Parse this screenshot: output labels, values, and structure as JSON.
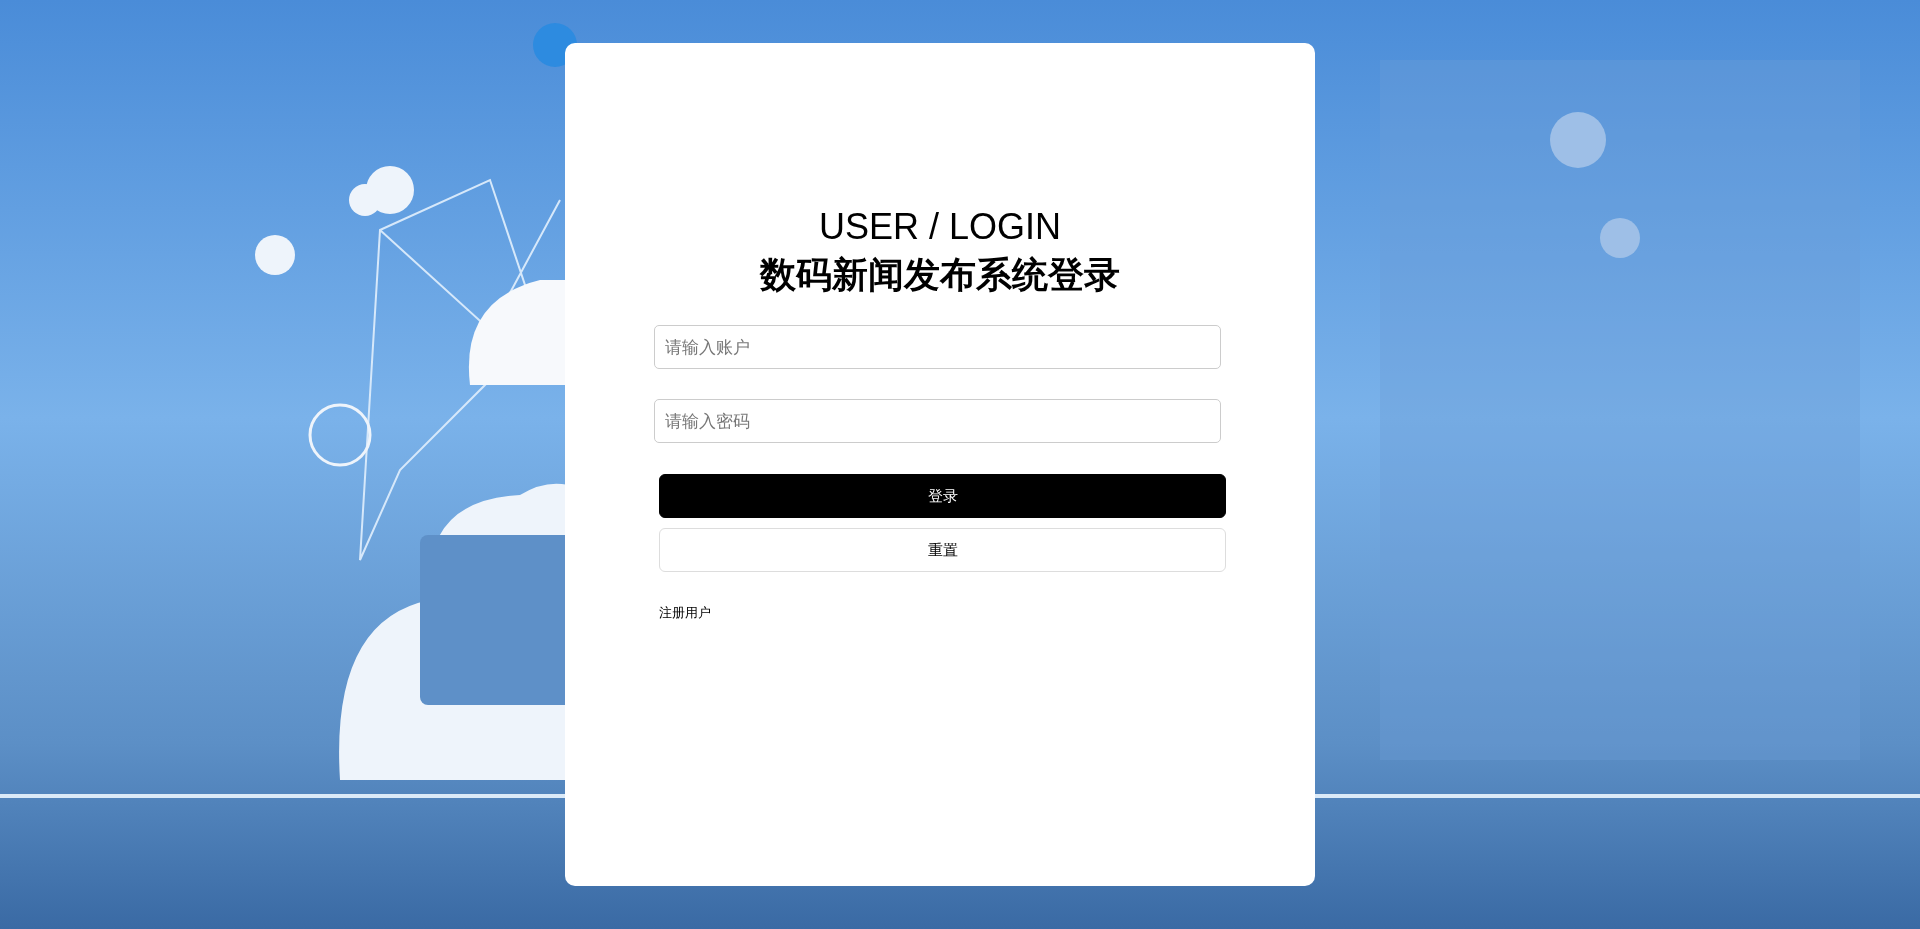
{
  "login": {
    "heading": "USER / LOGIN",
    "title": "数码新闻发布系统登录",
    "fields": [
      {
        "placeholder": "请输入账户"
      },
      {
        "placeholder": "请输入密码"
      }
    ],
    "buttons": [
      {
        "label": "登录",
        "kind": "primary"
      },
      {
        "label": "重置",
        "kind": "secondary"
      }
    ],
    "register_link": "注册用户"
  }
}
